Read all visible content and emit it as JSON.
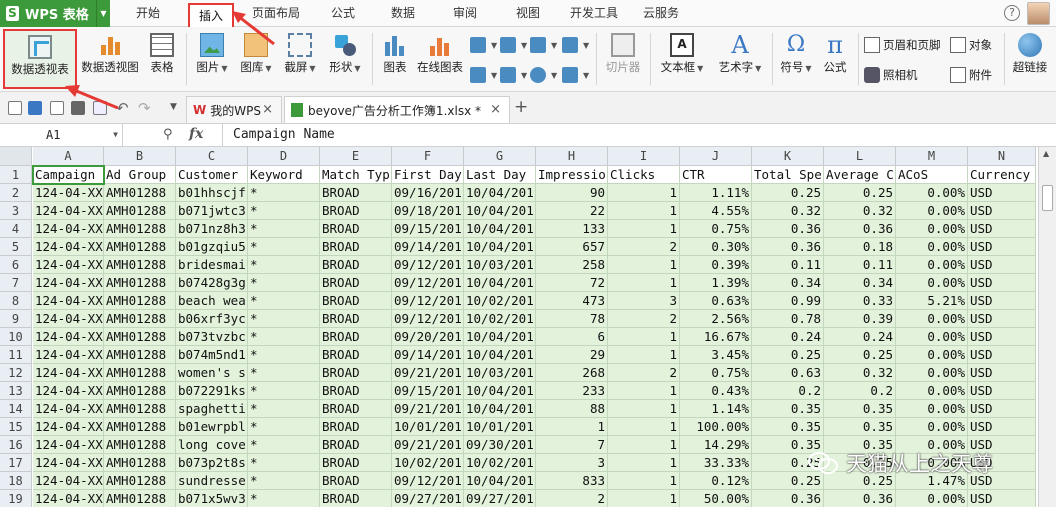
{
  "app": {
    "title": "WPS 表格"
  },
  "menu_tabs": [
    "开始",
    "插入",
    "页面布局",
    "公式",
    "数据",
    "审阅",
    "视图",
    "开发工具",
    "云服务"
  ],
  "active_tab": "插入",
  "ribbon": {
    "pivot_table": "数据透视表",
    "pivot_chart": "数据透视图",
    "table": "表格",
    "picture": "图片",
    "gallery": "图库",
    "screenshot": "截屏",
    "shapes": "形状",
    "chart": "图表",
    "online_chart": "在线图表",
    "slicer": "切片器",
    "textbox": "文本框",
    "wordart": "艺术字",
    "symbol": "符号",
    "formula": "公式",
    "header_footer": "页眉和页脚",
    "object": "对象",
    "camera": "照相机",
    "attachment": "附件",
    "hyperlink": "超链接"
  },
  "doc_tabs": [
    {
      "label": "我的WPS"
    },
    {
      "label": "beyove广告分析工作簿1.xlsx *"
    }
  ],
  "formula_bar": {
    "cell_ref": "A1",
    "fx": "fx",
    "content": "Campaign Name"
  },
  "grid": {
    "columns": [
      "A",
      "B",
      "C",
      "D",
      "E",
      "F",
      "G",
      "H",
      "I",
      "J",
      "K",
      "L",
      "M",
      "N"
    ],
    "rows": [
      "1",
      "2",
      "3",
      "4",
      "5",
      "6",
      "7",
      "8",
      "9",
      "10",
      "11",
      "12",
      "13",
      "14",
      "15",
      "16",
      "17",
      "18",
      "19"
    ],
    "headers": [
      "Campaign",
      "Ad Group",
      "Customer",
      "Keyword",
      "Match Typ",
      "First Day",
      "Last Day",
      "Impressio",
      "Clicks",
      "CTR",
      "Total Spe",
      "Average C",
      "ACoS",
      "Currency"
    ],
    "data": [
      [
        "124-04-XX",
        "AMH01288",
        "b01hhscjf",
        "*",
        "BROAD",
        "09/16/201",
        "10/04/201",
        "90",
        "1",
        "1.11%",
        "0.25",
        "0.25",
        "0.00%",
        "USD"
      ],
      [
        "124-04-XX",
        "AMH01288",
        "b071jwtc3",
        "*",
        "BROAD",
        "09/18/201",
        "10/04/201",
        "22",
        "1",
        "4.55%",
        "0.32",
        "0.32",
        "0.00%",
        "USD"
      ],
      [
        "124-04-XX",
        "AMH01288",
        "b071nz8h3",
        "*",
        "BROAD",
        "09/15/201",
        "10/04/201",
        "133",
        "1",
        "0.75%",
        "0.36",
        "0.36",
        "0.00%",
        "USD"
      ],
      [
        "124-04-XX",
        "AMH01288",
        "b01gzqiu5",
        "*",
        "BROAD",
        "09/14/201",
        "10/04/201",
        "657",
        "2",
        "0.30%",
        "0.36",
        "0.18",
        "0.00%",
        "USD"
      ],
      [
        "124-04-XX",
        "AMH01288",
        "bridesmai",
        "*",
        "BROAD",
        "09/12/201",
        "10/03/201",
        "258",
        "1",
        "0.39%",
        "0.11",
        "0.11",
        "0.00%",
        "USD"
      ],
      [
        "124-04-XX",
        "AMH01288",
        "b07428g3g",
        "*",
        "BROAD",
        "09/12/201",
        "10/04/201",
        "72",
        "1",
        "1.39%",
        "0.34",
        "0.34",
        "0.00%",
        "USD"
      ],
      [
        "124-04-XX",
        "AMH01288",
        "beach wea",
        "*",
        "BROAD",
        "09/12/201",
        "10/02/201",
        "473",
        "3",
        "0.63%",
        "0.99",
        "0.33",
        "5.21%",
        "USD"
      ],
      [
        "124-04-XX",
        "AMH01288",
        "b06xrf3yc",
        "*",
        "BROAD",
        "09/12/201",
        "10/02/201",
        "78",
        "2",
        "2.56%",
        "0.78",
        "0.39",
        "0.00%",
        "USD"
      ],
      [
        "124-04-XX",
        "AMH01288",
        "b073tvzbc",
        "*",
        "BROAD",
        "09/20/201",
        "10/04/201",
        "6",
        "1",
        "16.67%",
        "0.24",
        "0.24",
        "0.00%",
        "USD"
      ],
      [
        "124-04-XX",
        "AMH01288",
        "b074m5nd1",
        "*",
        "BROAD",
        "09/14/201",
        "10/04/201",
        "29",
        "1",
        "3.45%",
        "0.25",
        "0.25",
        "0.00%",
        "USD"
      ],
      [
        "124-04-XX",
        "AMH01288",
        "women's s",
        "*",
        "BROAD",
        "09/21/201",
        "10/03/201",
        "268",
        "2",
        "0.75%",
        "0.63",
        "0.32",
        "0.00%",
        "USD"
      ],
      [
        "124-04-XX",
        "AMH01288",
        "b072291ks",
        "*",
        "BROAD",
        "09/15/201",
        "10/04/201",
        "233",
        "1",
        "0.43%",
        "0.2",
        "0.2",
        "0.00%",
        "USD"
      ],
      [
        "124-04-XX",
        "AMH01288",
        "spaghetti",
        "*",
        "BROAD",
        "09/21/201",
        "10/04/201",
        "88",
        "1",
        "1.14%",
        "0.35",
        "0.35",
        "0.00%",
        "USD"
      ],
      [
        "124-04-XX",
        "AMH01288",
        "b01ewrpbl",
        "*",
        "BROAD",
        "10/01/201",
        "10/01/201",
        "1",
        "1",
        "100.00%",
        "0.35",
        "0.35",
        "0.00%",
        "USD"
      ],
      [
        "124-04-XX",
        "AMH01288",
        "long cove",
        "*",
        "BROAD",
        "09/21/201",
        "09/30/201",
        "7",
        "1",
        "14.29%",
        "0.35",
        "0.35",
        "0.00%",
        "USD"
      ],
      [
        "124-04-XX",
        "AMH01288",
        "b073p2t8s",
        "*",
        "BROAD",
        "10/02/201",
        "10/02/201",
        "3",
        "1",
        "33.33%",
        "0.25",
        "0.25",
        "0.00%",
        "USD"
      ],
      [
        "124-04-XX",
        "AMH01288",
        "sundresse",
        "*",
        "BROAD",
        "09/12/201",
        "10/04/201",
        "833",
        "1",
        "0.12%",
        "0.25",
        "0.25",
        "1.47%",
        "USD"
      ],
      [
        "124-04-XX",
        "AMH01288",
        "b071x5wv3",
        "*",
        "BROAD",
        "09/27/201",
        "09/27/201",
        "2",
        "1",
        "50.00%",
        "0.36",
        "0.36",
        "0.00%",
        "USD"
      ]
    ],
    "numeric_columns": [
      7,
      8,
      9,
      10,
      11,
      12
    ]
  },
  "watermark": {
    "text": "天猫从上之天尊"
  },
  "colors": {
    "brand_green": "#3d9a3a",
    "selection_red": "#e53935",
    "cell_green": "#e3f2db",
    "header_bg": "#e8eef3"
  },
  "icons": [
    "pivot-table-icon",
    "pivot-chart-icon",
    "table-icon",
    "picture-icon",
    "gallery-icon",
    "screenshot-icon",
    "shapes-icon",
    "chart-icon",
    "online-chart-icon",
    "slicer-icon",
    "textbox-icon",
    "wordart-icon",
    "symbol-icon",
    "formula-icon",
    "hyperlink-icon",
    "wechat-icon"
  ]
}
